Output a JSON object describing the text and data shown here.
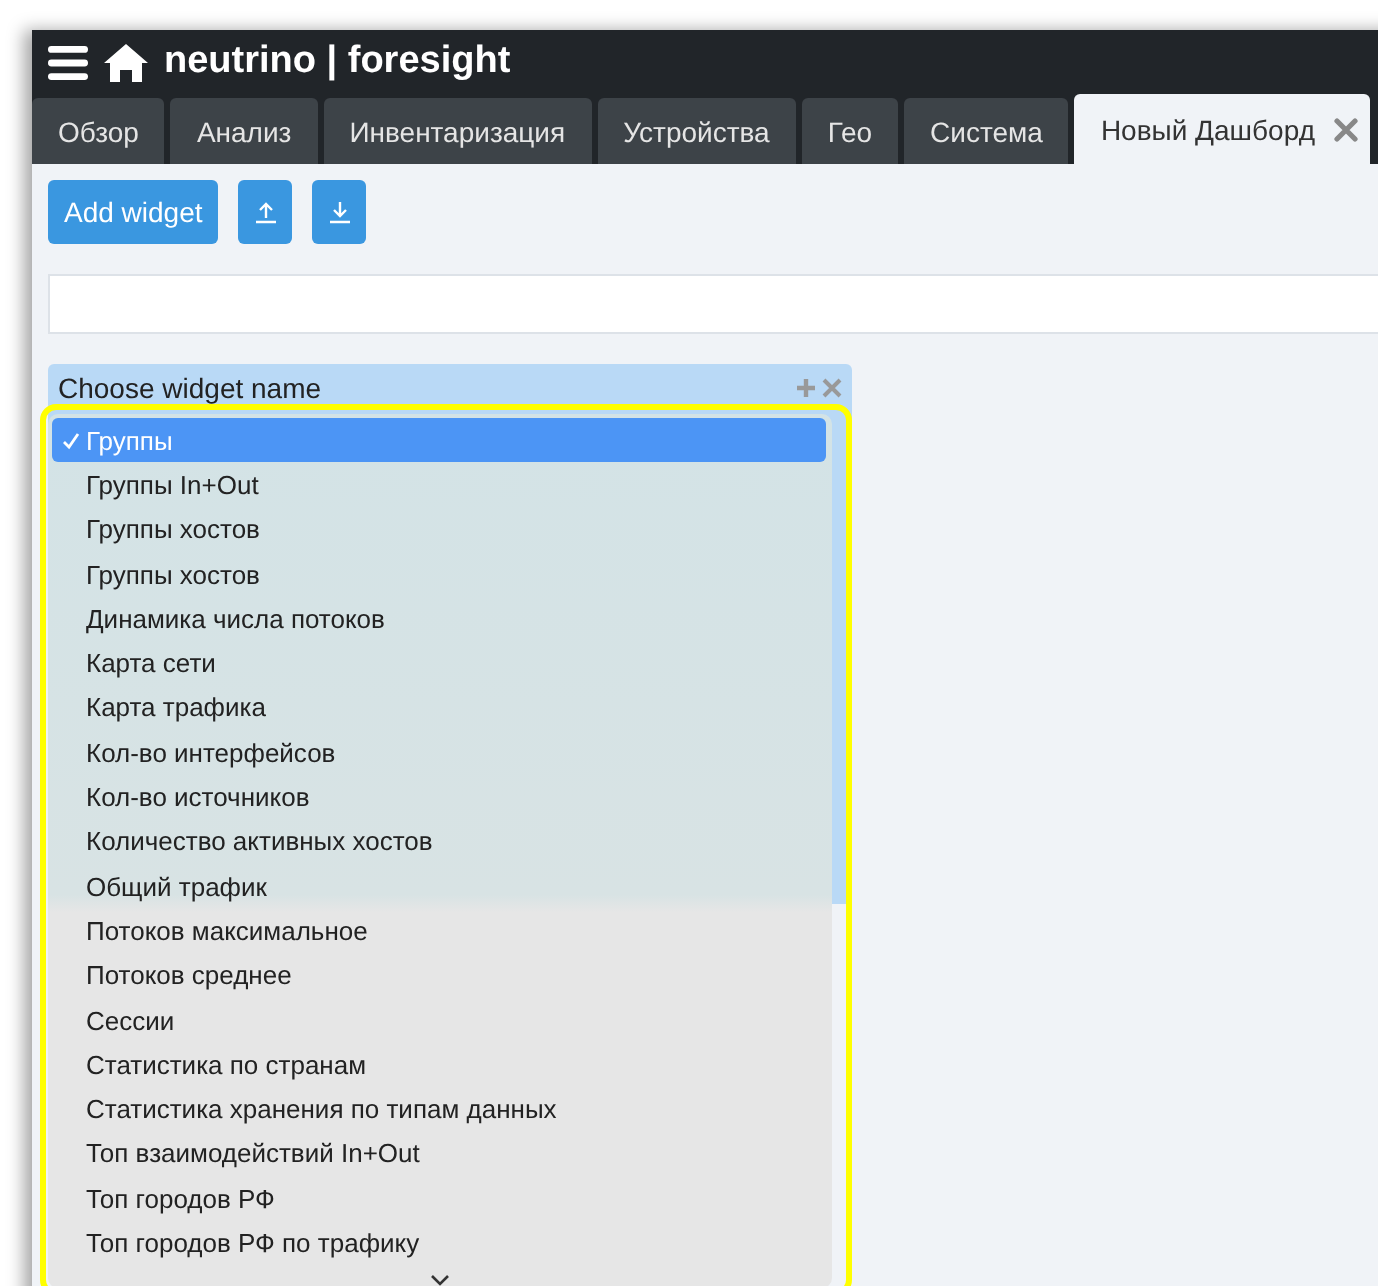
{
  "header": {
    "title": "neutrino | foresight"
  },
  "tabs": [
    {
      "label": "Обзор",
      "selected": false,
      "closable": false
    },
    {
      "label": "Анализ",
      "selected": false,
      "closable": false
    },
    {
      "label": "Инвентаризация",
      "selected": false,
      "closable": false
    },
    {
      "label": "Устройства",
      "selected": false,
      "closable": false
    },
    {
      "label": "Гео",
      "selected": false,
      "closable": false
    },
    {
      "label": "Система",
      "selected": false,
      "closable": false
    },
    {
      "label": "Новый Дашборд",
      "selected": true,
      "closable": true
    }
  ],
  "toolbar": {
    "add_button": "Add widget"
  },
  "widget": {
    "title": "Choose widget name"
  },
  "dropdown": {
    "items": [
      {
        "label": "Группы",
        "selected": true
      },
      {
        "label": "Группы In+Out",
        "selected": false
      },
      {
        "label": "Группы хостов",
        "selected": false
      },
      {
        "label": "Группы хостов",
        "selected": false
      },
      {
        "label": "Динамика числа потоков",
        "selected": false
      },
      {
        "label": "Карта сети",
        "selected": false
      },
      {
        "label": "Карта трафика",
        "selected": false
      },
      {
        "label": "Кол-во интерфейсов",
        "selected": false
      },
      {
        "label": "Кол-во источников",
        "selected": false
      },
      {
        "label": "Количество активных хостов",
        "selected": false
      },
      {
        "label": "Общий трафик",
        "selected": false
      },
      {
        "label": "Потоков максимальное",
        "selected": false
      },
      {
        "label": "Потоков среднее",
        "selected": false
      },
      {
        "label": "Сессии",
        "selected": false
      },
      {
        "label": "Статистика по странам",
        "selected": false
      },
      {
        "label": "Статистика хранения по типам данных",
        "selected": false
      },
      {
        "label": "Топ взаимодействий In+Out",
        "selected": false
      },
      {
        "label": "Топ городов РФ",
        "selected": false
      },
      {
        "label": "Топ городов РФ по трафику",
        "selected": false
      }
    ]
  }
}
